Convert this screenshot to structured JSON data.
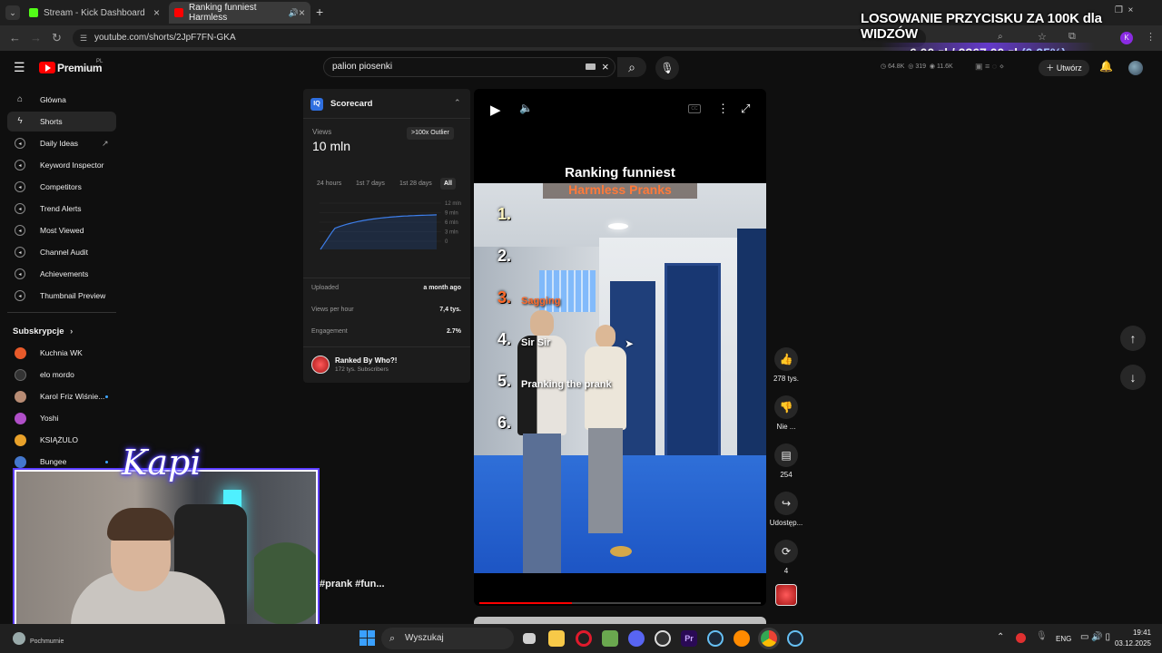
{
  "browser": {
    "tabs": [
      {
        "title": "Stream - Kick Dashboard",
        "icon": "kick-icon",
        "color": "#53fc18"
      },
      {
        "title": "Ranking funniest Harmless",
        "icon": "youtube-icon",
        "color": "#ff0000"
      }
    ],
    "url": "youtube.com/shorts/2JpF7FN-GKA"
  },
  "overlay": {
    "title": "LOSOWANIE PRZYCISKU ZA 100K dla WIDZÓW",
    "amount": "6,00 zł / 2367,00 zł",
    "percent": "(0.25%)"
  },
  "header": {
    "logo_text": "Premium",
    "logo_badge": "PL",
    "search_value": "palion piosenki",
    "create_label": "Utwórz",
    "stats": [
      "64.8K",
      "319",
      "11.6K"
    ]
  },
  "sidebar": {
    "items": [
      {
        "label": "Główna",
        "icon": "home-icon"
      },
      {
        "label": "Shorts",
        "icon": "shorts-icon"
      },
      {
        "label": "Daily Ideas",
        "icon": "vidiq-icon"
      },
      {
        "label": "Keyword Inspector",
        "icon": "vidiq-icon"
      },
      {
        "label": "Competitors",
        "icon": "vidiq-icon"
      },
      {
        "label": "Trend Alerts",
        "icon": "vidiq-icon"
      },
      {
        "label": "Most Viewed",
        "icon": "vidiq-icon"
      },
      {
        "label": "Channel Audit",
        "icon": "vidiq-icon"
      },
      {
        "label": "Achievements",
        "icon": "vidiq-icon"
      },
      {
        "label": "Thumbnail Preview",
        "icon": "vidiq-icon"
      }
    ],
    "subscriptions_title": "Subskrypcje",
    "subscriptions": [
      {
        "name": "Kuchnia WK",
        "color": "#e85a2a"
      },
      {
        "name": "elo mordo",
        "color": "#333333"
      },
      {
        "name": "Karol Friz Wiśnie...",
        "color": "#b88c74"
      },
      {
        "name": "Yoshi",
        "color": "#b04fc8"
      },
      {
        "name": "KSIĄŻULO",
        "color": "#e8a12a"
      },
      {
        "name": "Bungee",
        "color": "#4477cc"
      }
    ]
  },
  "scorecard": {
    "title": "Scorecard",
    "views_label": "Views",
    "views_value": "10 mln",
    "outlier_badge": ">100x Outlier",
    "ranges": [
      "24 hours",
      "1st 7 days",
      "1st 28 days",
      "All"
    ],
    "active_range": "All",
    "y_ticks": [
      "12 mln",
      "9 mln",
      "6 mln",
      "3 mln",
      "0"
    ],
    "rows": [
      {
        "label": "Uploaded",
        "value": "a month ago"
      },
      {
        "label": "Views per hour",
        "value": "7,4 tys."
      },
      {
        "label": "Engagement",
        "value": "2.7%"
      }
    ],
    "channel_name": "Ranked By Who?!",
    "channel_subs": "172 tys. Subscribers"
  },
  "video": {
    "title_line1": "Ranking funniest",
    "title_line2": "Harmless Pranks",
    "ranks": [
      {
        "num": "1.",
        "label": ""
      },
      {
        "num": "2.",
        "label": ""
      },
      {
        "num": "3.",
        "label": "Sagging"
      },
      {
        "num": "4.",
        "label": "Sir Sir"
      },
      {
        "num": "5.",
        "label": "Pranking the prank"
      },
      {
        "num": "6.",
        "label": ""
      }
    ],
    "hashtags": "#prank #fun...",
    "progress": 0.33
  },
  "actions": {
    "likes": "278 tys.",
    "dislike": "Nie ...",
    "comments": "254",
    "share": "Udostęp...",
    "remix": "4"
  },
  "webcam": {
    "signature": "Kapi",
    "caption": "Pochmurnie"
  },
  "taskbar": {
    "search": "Wyszukaj",
    "lang": "ENG",
    "time": "19:41",
    "date": "03.12.2025"
  }
}
